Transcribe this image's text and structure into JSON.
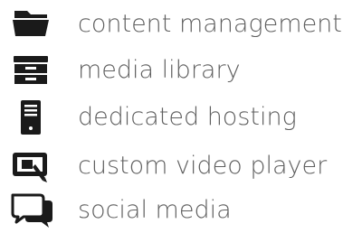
{
  "features": {
    "items": [
      {
        "label": "content management",
        "icon": "folder-icon"
      },
      {
        "label": "media library",
        "icon": "file-cabinet-icon"
      },
      {
        "label": "dedicated hosting",
        "icon": "server-icon"
      },
      {
        "label": "custom video player",
        "icon": "video-player-icon"
      },
      {
        "label": "social media",
        "icon": "chat-bubbles-icon"
      }
    ]
  },
  "colors": {
    "icon": "#1a1a1a",
    "text": "#5f5f5f",
    "background": "#ffffff"
  }
}
